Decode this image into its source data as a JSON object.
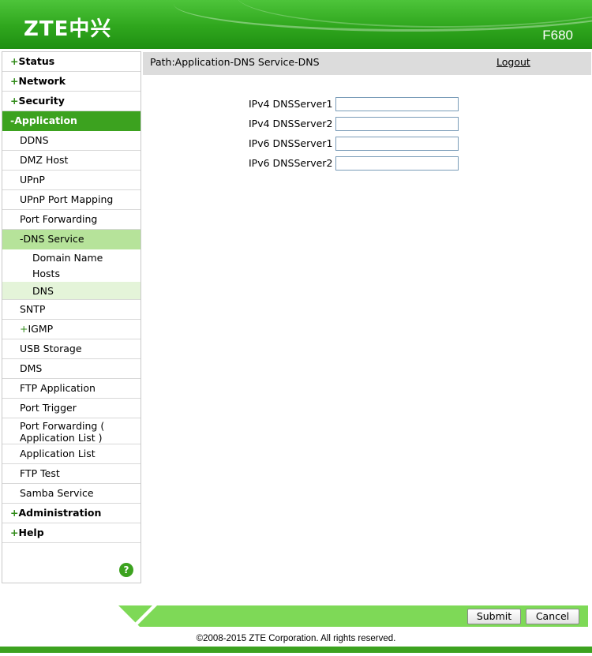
{
  "header": {
    "logo": "ZTE中兴",
    "model": "F680"
  },
  "sidebar": {
    "items": [
      {
        "label": "Status",
        "prefix": "+"
      },
      {
        "label": "Network",
        "prefix": "+"
      },
      {
        "label": "Security",
        "prefix": "+"
      },
      {
        "label": "Application",
        "prefix": "-"
      },
      {
        "label": "DDNS"
      },
      {
        "label": "DMZ Host"
      },
      {
        "label": "UPnP"
      },
      {
        "label": "UPnP Port Mapping"
      },
      {
        "label": "Port Forwarding"
      },
      {
        "label": "DNS Service",
        "prefix": "-"
      },
      {
        "label": "Domain Name"
      },
      {
        "label": "Hosts"
      },
      {
        "label": "DNS"
      },
      {
        "label": "SNTP"
      },
      {
        "label": "IGMP",
        "prefix": "+"
      },
      {
        "label": "USB Storage"
      },
      {
        "label": "DMS"
      },
      {
        "label": "FTP Application"
      },
      {
        "label": "Port Trigger"
      },
      {
        "label": "Port Forwarding ( Application List )",
        "line1": "Port Forwarding (",
        "line2": "Application List )"
      },
      {
        "label": "Application List"
      },
      {
        "label": "FTP Test"
      },
      {
        "label": "Samba Service"
      },
      {
        "label": "Administration",
        "prefix": "+"
      },
      {
        "label": "Help",
        "prefix": "+"
      }
    ],
    "help_icon": "?"
  },
  "pathbar": {
    "path": "Path:Application-DNS Service-DNS",
    "logout": "Logout"
  },
  "form": {
    "fields": [
      {
        "label": "IPv4 DNSServer1",
        "value": ""
      },
      {
        "label": "IPv4 DNSServer2",
        "value": ""
      },
      {
        "label": "IPv6 DNSServer1",
        "value": ""
      },
      {
        "label": "IPv6 DNSServer2",
        "value": ""
      }
    ]
  },
  "buttons": {
    "submit": "Submit",
    "cancel": "Cancel"
  },
  "footer": {
    "copyright": "©2008-2015 ZTE Corporation. All rights reserved."
  },
  "colors": {
    "brand_green": "#3ca21f",
    "active_sub": "#b6e39a",
    "active_subsub": "#e4f4d9",
    "footer_band": "#7ed957"
  }
}
